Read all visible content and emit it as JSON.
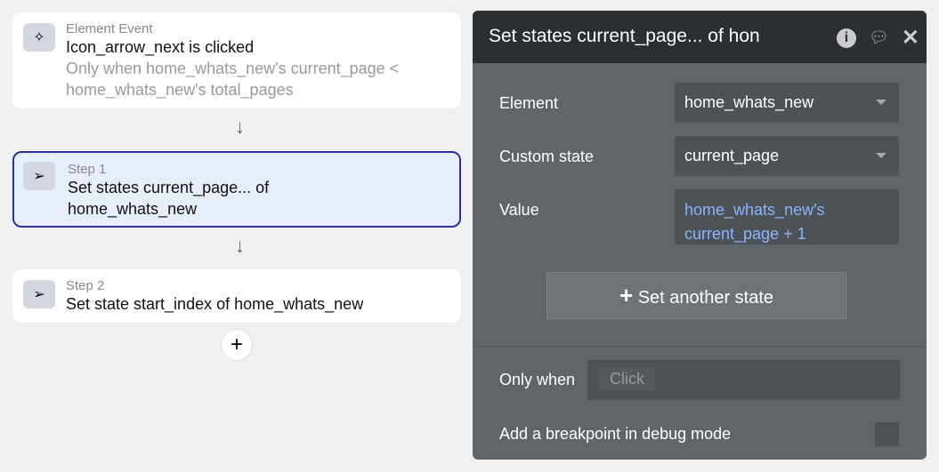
{
  "event": {
    "label": "Element Event",
    "title": "Icon_arrow_next is clicked",
    "condition": "Only when home_whats_new's current_page < home_whats_new's total_pages"
  },
  "steps": [
    {
      "label": "Step 1",
      "title": "Set states current_page... of home_whats_new"
    },
    {
      "label": "Step 2",
      "title": "Set state start_index of home_whats_new"
    }
  ],
  "panel": {
    "title": "Set states current_page... of hon",
    "element_label": "Element",
    "element_value": "home_whats_new",
    "state_label": "Custom state",
    "state_value": "current_page",
    "value_label": "Value",
    "value_expr": "home_whats_new's current_page + 1",
    "add_state": "Set another state",
    "only_when": "Only when",
    "click_placeholder": "Click",
    "breakpoint": "Add a breakpoint in debug mode"
  }
}
